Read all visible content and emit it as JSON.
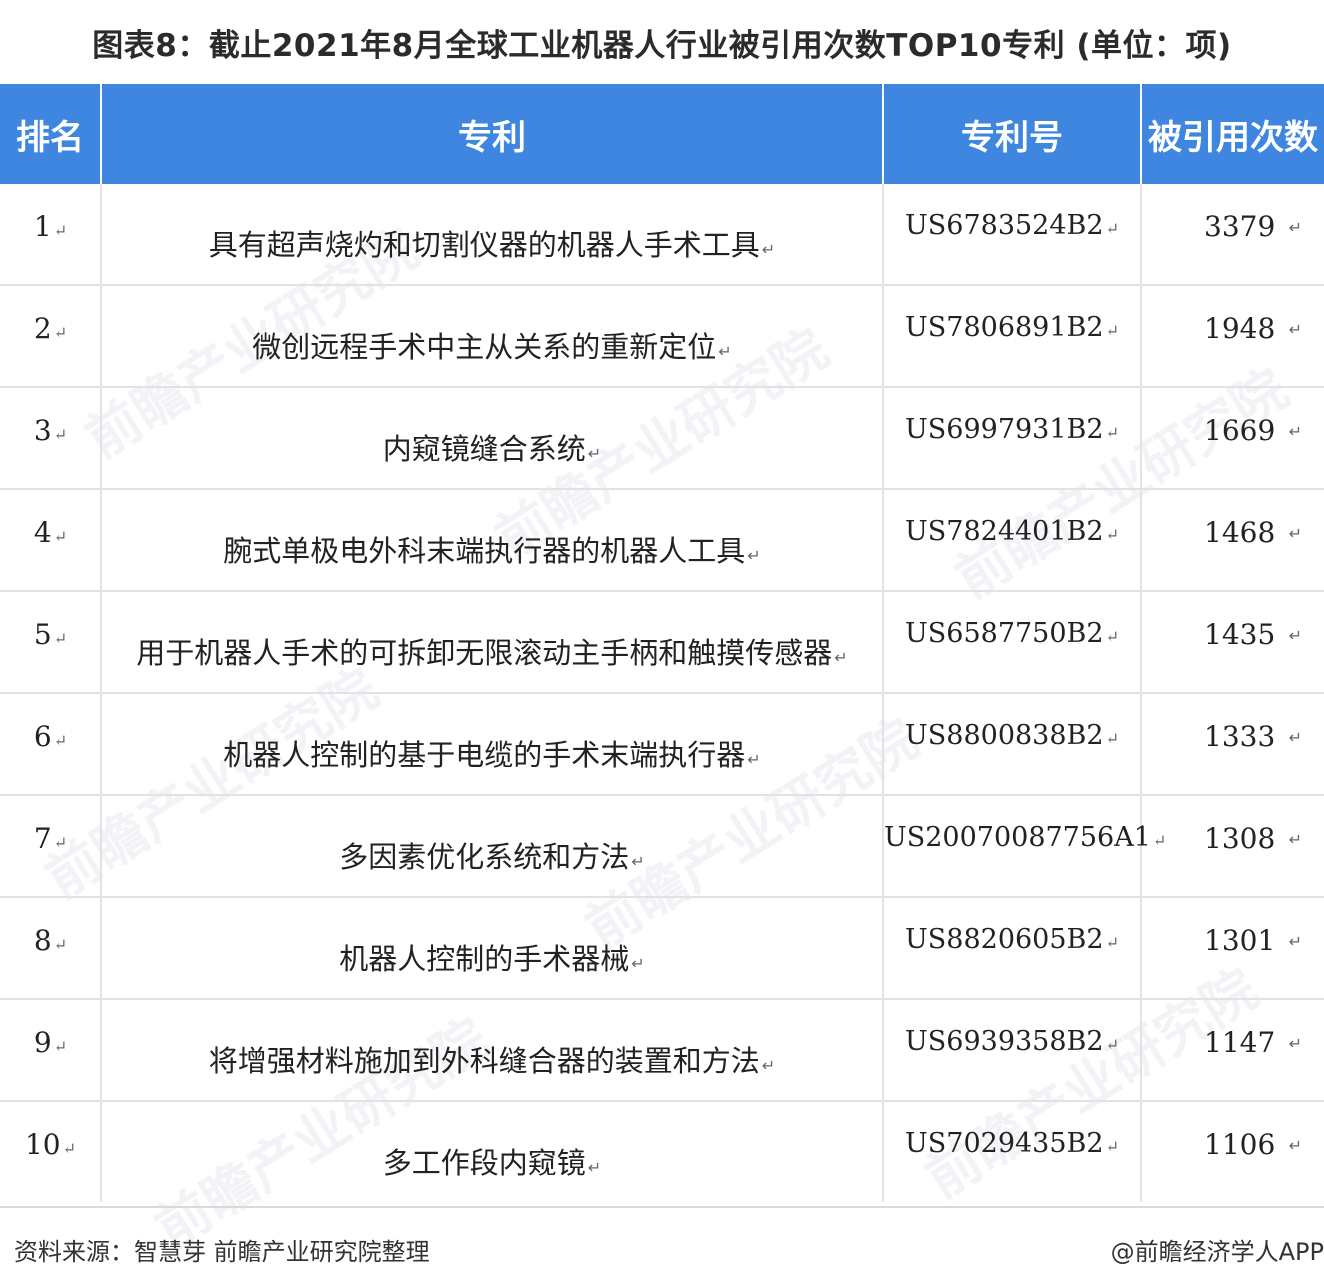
{
  "title": "图表8：截止2021年8月全球工业机器人行业被引用次数TOP10专利 (单位：项)",
  "table": {
    "headers": [
      "排名",
      "专利",
      "专利号",
      "被引用次数"
    ],
    "return_mark": "↵",
    "rows": [
      {
        "rank": "1",
        "name": "具有超声烧灼和切割仪器的机器人手术工具",
        "patent_no": "US6783524B2",
        "cites": "3379"
      },
      {
        "rank": "2",
        "name": "微创远程手术中主从关系的重新定位",
        "patent_no": "US7806891B2",
        "cites": "1948"
      },
      {
        "rank": "3",
        "name": "内窥镜缝合系统",
        "patent_no": "US6997931B2",
        "cites": "1669"
      },
      {
        "rank": "4",
        "name": "腕式单极电外科末端执行器的机器人工具",
        "patent_no": "US7824401B2",
        "cites": "1468"
      },
      {
        "rank": "5",
        "name": "用于机器人手术的可拆卸无限滚动主手柄和触摸传感器",
        "patent_no": "US6587750B2",
        "cites": "1435"
      },
      {
        "rank": "6",
        "name": "机器人控制的基于电缆的手术末端执行器",
        "patent_no": "US8800838B2",
        "cites": "1333"
      },
      {
        "rank": "7",
        "name": "多因素优化系统和方法",
        "patent_no": "US20070087756A1",
        "cites": "1308"
      },
      {
        "rank": "8",
        "name": "机器人控制的手术器械",
        "patent_no": "US8820605B2",
        "cites": "1301"
      },
      {
        "rank": "9",
        "name": "将增强材料施加到外科缝合器的装置和方法",
        "patent_no": "US6939358B2",
        "cites": "1147"
      },
      {
        "rank": "10",
        "name": "多工作段内窥镜",
        "patent_no": "US7029435B2",
        "cites": "1106"
      }
    ]
  },
  "footer": {
    "source": "资料来源：智慧芽 前瞻产业研究院整理",
    "brand": "@前瞻经济学人APP"
  },
  "watermark": "前瞻产业研究院"
}
